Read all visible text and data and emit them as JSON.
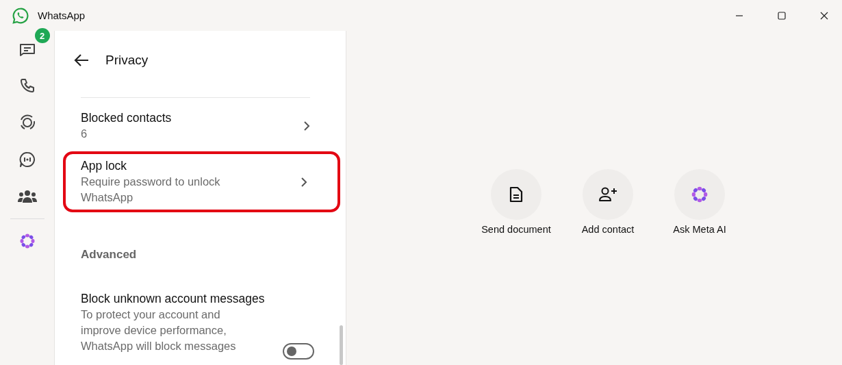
{
  "window": {
    "title": "WhatsApp"
  },
  "nav": [
    {
      "kind": "chats",
      "badge": "2"
    },
    {
      "kind": "calls"
    },
    {
      "kind": "status"
    },
    {
      "kind": "channels"
    },
    {
      "kind": "communities"
    },
    {
      "kind": "meta"
    }
  ],
  "panel": {
    "title": "Privacy"
  },
  "settings": [
    {
      "kind": "link",
      "label": "Blocked contacts",
      "detail": "6",
      "highlighted": false
    },
    {
      "kind": "link",
      "label": "App lock",
      "detail": "Require password to unlock WhatsApp",
      "highlighted": true
    },
    {
      "kind": "header",
      "label": "Advanced"
    },
    {
      "kind": "toggle",
      "label": "Block unknown account messages",
      "detail": "To protect your account and improve device performance, WhatsApp will block messages",
      "checked": false
    }
  ],
  "actions": [
    {
      "kind": "document",
      "label": "Send document"
    },
    {
      "kind": "contact",
      "label": "Add contact"
    },
    {
      "kind": "meta",
      "label": "Ask Meta AI"
    }
  ]
}
